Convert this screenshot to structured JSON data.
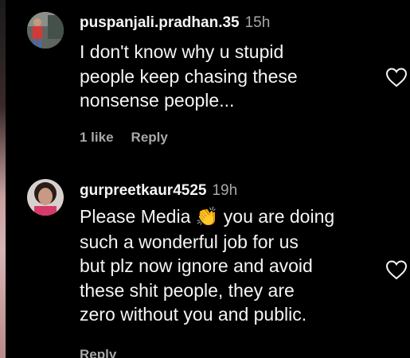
{
  "comments": [
    {
      "username": "puspanjali.pradhan.35",
      "time": "15h",
      "text": "I don't know why u stupid\npeople keep chasing these\nnonsense people...",
      "likes": "1 like",
      "reply": "Reply"
    },
    {
      "username": "gurpreetkaur4525",
      "time": "19h",
      "text_before_emoji": "Please Media ",
      "emoji": "👏",
      "text_after_emoji": " you are doing\nsuch a wonderful job for us\nbut plz now ignore and avoid\nthese shit people, they are\nzero without you and public.",
      "reply": "Reply"
    }
  ],
  "icons": {
    "like": "heart-outline-icon"
  },
  "colors": {
    "background": "#000000",
    "primary_text": "#f5f5f5",
    "secondary_text": "#a8a8a8"
  }
}
